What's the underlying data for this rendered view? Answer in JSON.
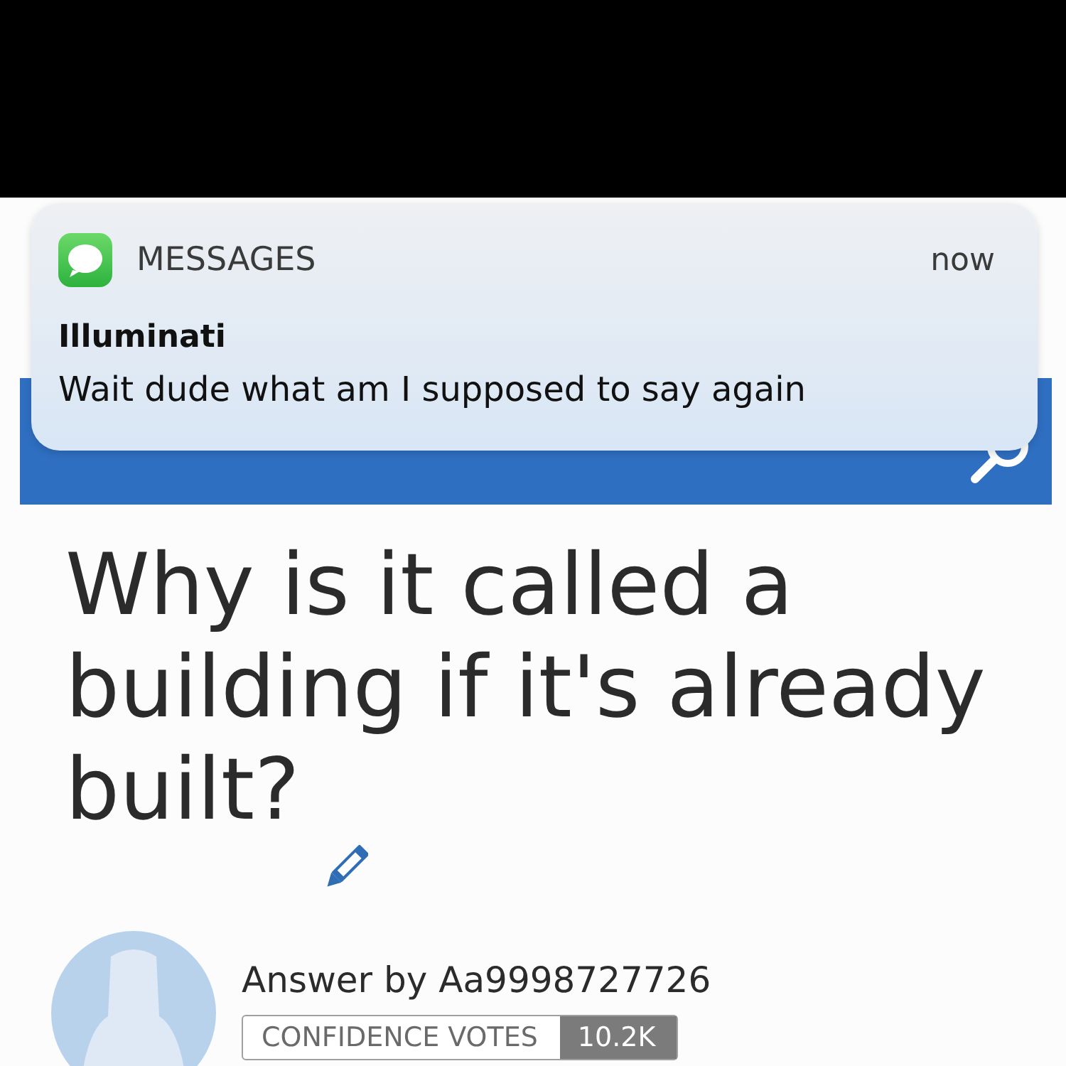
{
  "notification": {
    "app": "MESSAGES",
    "time": "now",
    "sender": "Illuminati",
    "message": "Wait dude what am I supposed to say again"
  },
  "question": {
    "title": "Why is it called a building if it's already built?"
  },
  "answer": {
    "author_line": "Answer by Aa9998727726",
    "confidence_label": "CONFIDENCE VOTES",
    "confidence_count": "10.2K"
  }
}
